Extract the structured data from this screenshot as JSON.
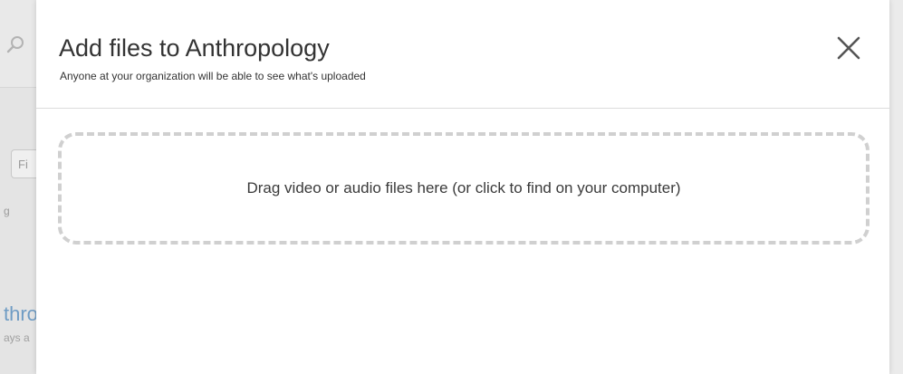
{
  "background": {
    "filter_text": "Fi",
    "small_text": "g",
    "link_text": "thro",
    "meta_text": "ays a"
  },
  "modal": {
    "title": "Add files to Anthropology",
    "subtitle": "Anyone at your organization will be able to see what's uploaded",
    "close_icon": "close-icon",
    "dropzone_text": "Drag video or audio files here (or click to find on your computer)"
  },
  "colors": {
    "overlay": "#e4e4e4",
    "modal_bg": "#ffffff",
    "title": "#333333",
    "dropzone_border": "#d0d0d0",
    "close_icon": "#555555",
    "bg_link": "#6f9cc4"
  }
}
